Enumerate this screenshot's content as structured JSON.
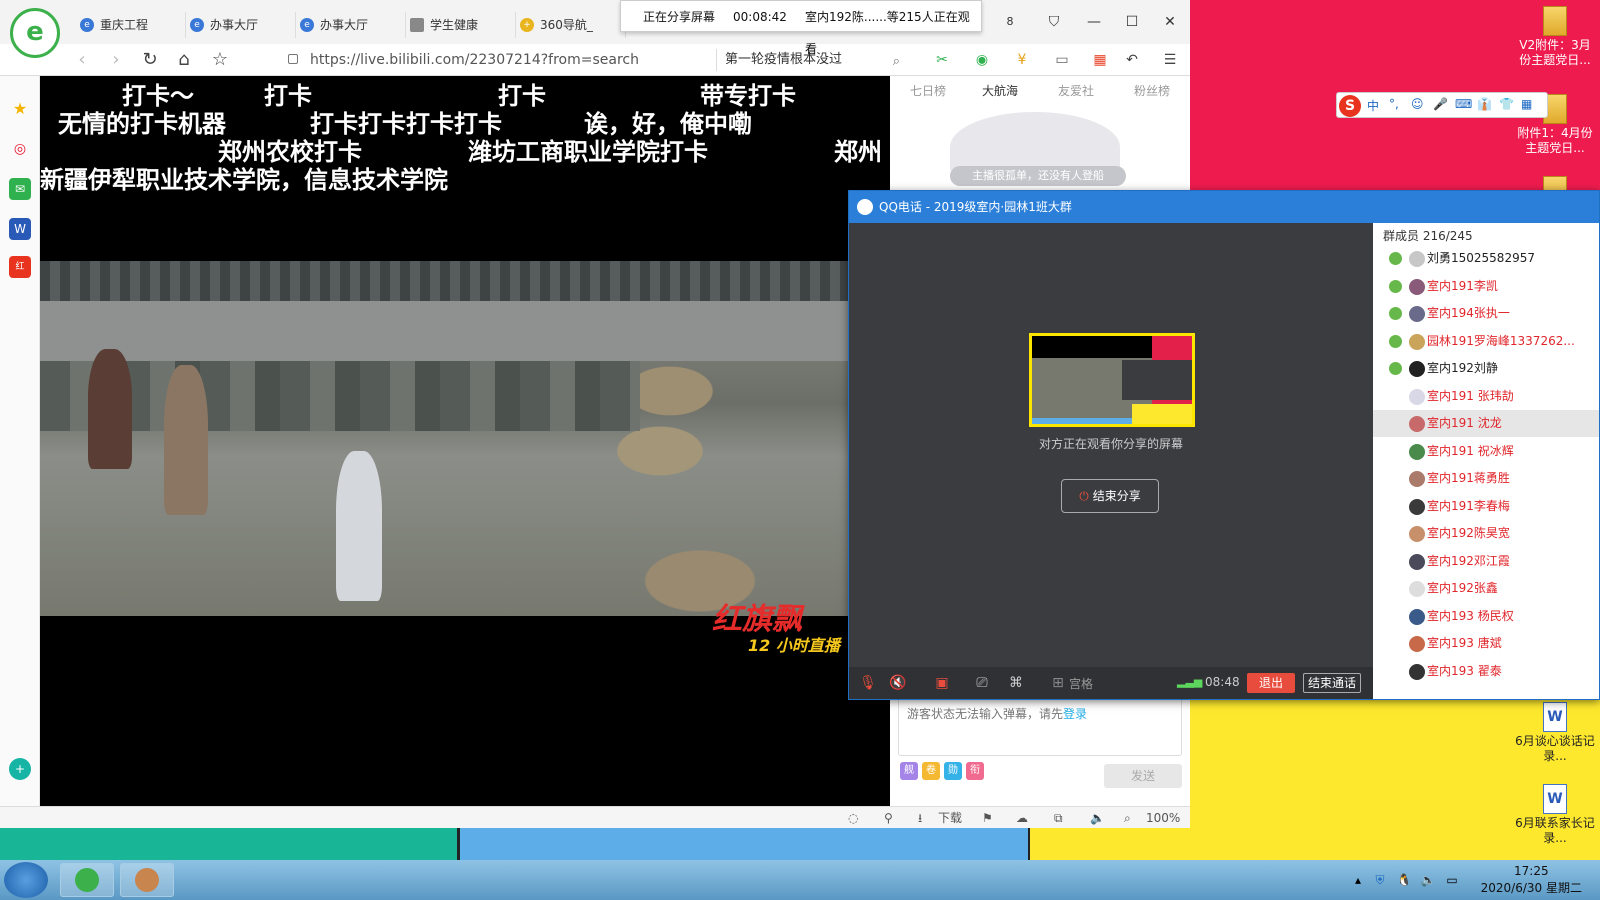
{
  "browser": {
    "tabs": [
      "重庆工程",
      "办事大厅",
      "办事大厅",
      "学生健康",
      "360导航_"
    ],
    "url": "https://live.bilibili.com/22307214?from=search",
    "search_value": "第一轮疫情根本没过",
    "status": {
      "download": "下载",
      "zoom": "100%"
    }
  },
  "share_banner": {
    "label": "正在分享屏幕",
    "timer": "00:08:42",
    "viewers": "室内192陈......等215人正在观看"
  },
  "video": {
    "danmaku": [
      "打卡～",
      "打卡",
      "打卡",
      "带专打卡",
      "无情的打卡机器",
      "打卡打卡打卡打卡",
      "诶，好，俺中嘞",
      "郑州农校打卡",
      "潍坊工商职业学院打卡",
      "郑州",
      "新疆伊犁职业技术学院，信息技术学院"
    ],
    "watermark": "红旗飘",
    "watermark2": "12 小时直播"
  },
  "rightpanel": {
    "tabs": [
      "七日榜",
      "大航海",
      "友爱社",
      "粉丝榜"
    ],
    "empty_msg": "主播很孤单，还没有人登船",
    "chat_placeholder": "游客状态无法输入弹幕，请先",
    "login_link": "登录",
    "emotes": [
      "舰",
      "卷",
      "勋",
      "衔"
    ],
    "send": "发送"
  },
  "qq": {
    "title": "QQ电话 - 2019级室内·园林1班大群",
    "watching": "对方正在观看你分享的屏幕",
    "end_share": "结束分享",
    "grid_label": "宫格",
    "time": "08:48",
    "exit": "退出",
    "end_call": "结束通话",
    "member_header": "群成员 216/245",
    "members": [
      "刘勇15025582957",
      "室内191李凯",
      "室内194张执一",
      "园林191罗海峰1337262...",
      "室内192刘静",
      "室内191  张玮劼",
      "室内191 沈龙",
      "室内191 祝冰辉",
      "室内191蒋勇胜",
      "室内191李春梅",
      "室内192陈昊宽",
      "室内192邓江霞",
      "室内192张鑫",
      "室内193  杨民权",
      "室内193 唐斌",
      "室内193 翟泰"
    ]
  },
  "desktop_icons": [
    {
      "label": "V2附件：3月份主题党日..."
    },
    {
      "label": "附件1：4月份主题党日..."
    },
    {
      "label": "6月谈心谈话记录..."
    },
    {
      "label": "6月联系家长记录..."
    }
  ],
  "ime": {
    "keys": [
      "中",
      "°,",
      "☺",
      "🎤",
      "⌨",
      "👔",
      "👕",
      "▦"
    ]
  },
  "taskbar": {
    "time": "17:25",
    "date": "2020/6/30 星期二"
  },
  "colors": {
    "qq_blue": "#2b7fd8",
    "exit_red": "#e84c3d",
    "member_red": "#e0262b",
    "desk_red": "#ee1c4e",
    "desk_yellow": "#fde82d"
  }
}
